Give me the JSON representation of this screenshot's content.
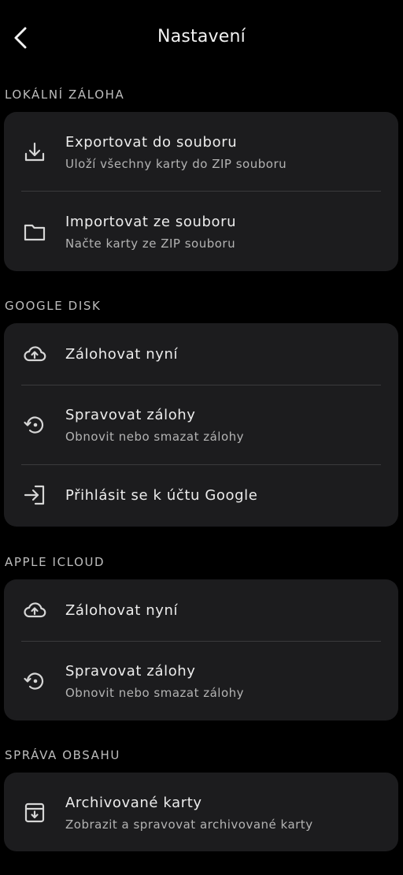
{
  "header": {
    "title": "Nastavení",
    "back_icon": "chevron-left-icon"
  },
  "sections": {
    "local": {
      "title": "LOKÁLNÍ ZÁLOHA",
      "items": [
        {
          "label": "Exportovat do souboru",
          "sub": "Uloží všechny karty do ZIP souboru",
          "icon": "download-icon"
        },
        {
          "label": "Importovat ze souboru",
          "sub": "Načte karty ze ZIP souboru",
          "icon": "folder-icon"
        }
      ]
    },
    "google": {
      "title": "GOOGLE DISK",
      "items": [
        {
          "label": "Zálohovat nyní",
          "icon": "cloud-upload-icon"
        },
        {
          "label": "Spravovat zálohy",
          "sub": "Obnovit nebo smazat zálohy",
          "icon": "restore-icon"
        },
        {
          "label": "Přihlásit se k účtu Google",
          "icon": "login-icon"
        }
      ]
    },
    "icloud": {
      "title": "APPLE ICLOUD",
      "items": [
        {
          "label": "Zálohovat nyní",
          "icon": "cloud-upload-icon"
        },
        {
          "label": "Spravovat zálohy",
          "sub": "Obnovit nebo smazat zálohy",
          "icon": "restore-icon"
        }
      ]
    },
    "content": {
      "title": "SPRÁVA OBSAHU",
      "items": [
        {
          "label": "Archivované karty",
          "sub": "Zobrazit a spravovat archivované karty",
          "icon": "archive-icon"
        }
      ]
    }
  },
  "colors": {
    "background": "#000000",
    "card": "#1C1C1E",
    "divider": "#3A3A3C",
    "text": "#ECECEC",
    "secondary_text": "#B3B3B3",
    "section_text": "#BDBDBD"
  }
}
